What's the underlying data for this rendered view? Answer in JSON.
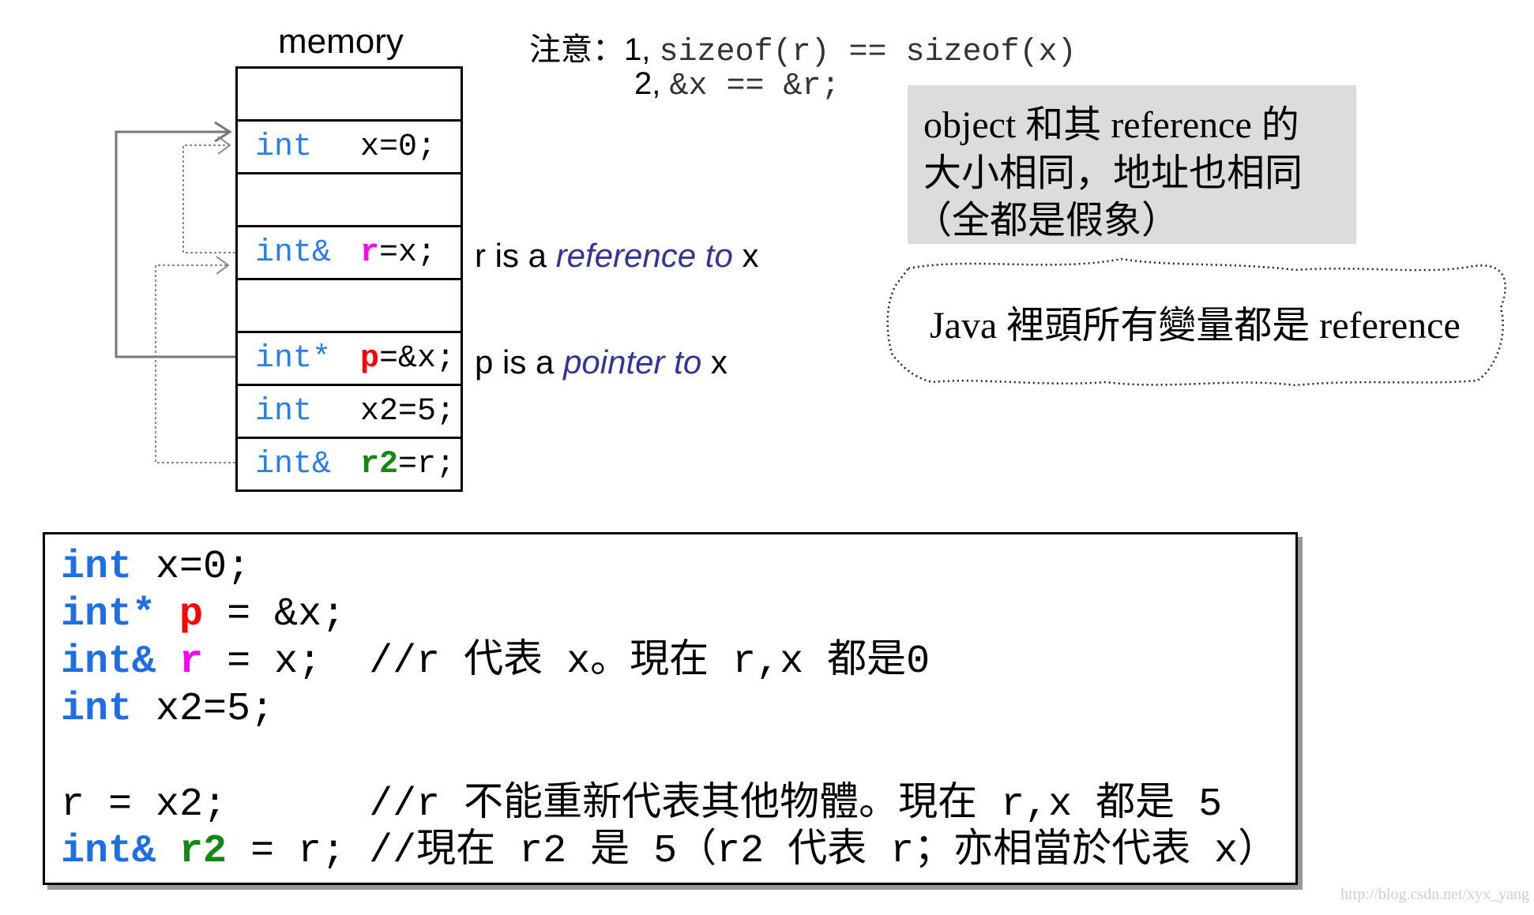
{
  "colors": {
    "type": "#2a7fe6",
    "pointer_var": "#ff0000",
    "ref_var": "#ff00ff",
    "ref2_var": "#118811",
    "gray_box": "#dcdcdc",
    "italic": "#333399"
  },
  "memory": {
    "title": "memory",
    "cells": [
      {
        "type": "",
        "value": ""
      },
      {
        "type": "int",
        "value": "x=0;"
      },
      {
        "type": "",
        "value": ""
      },
      {
        "type": "int&",
        "var": "r",
        "rest": "=x;"
      },
      {
        "type": "",
        "value": ""
      },
      {
        "type": "int*",
        "var": "p",
        "rest": "=&x;"
      },
      {
        "type": "int",
        "value": "x2=5;"
      },
      {
        "type": "int&",
        "var": "r2",
        "rest": "=r;"
      }
    ]
  },
  "notes": {
    "label": "注意：",
    "line1_num": "1,",
    "line1_code": "sizeof(r) == sizeof(x)",
    "line2_num": "2,",
    "line2_code": "&x == &r;"
  },
  "annotations": {
    "ref": {
      "pre": "r is a ",
      "em": "reference to",
      "post": " x"
    },
    "ptr": {
      "pre": "p is a ",
      "em": "pointer to",
      "post": " x"
    }
  },
  "gray_box": {
    "lines": [
      "object 和其 reference 的",
      "大小相同，地址也相同",
      "（全都是假象）"
    ]
  },
  "cloud": {
    "text": "Java 裡頭所有變量都是 reference"
  },
  "code": {
    "l1": {
      "kw": "int",
      "rest": " x=0;"
    },
    "l2": {
      "kw": "int*",
      "var": "p",
      "rest": " = &x;"
    },
    "l3": {
      "kw": "int&",
      "var": "r",
      "rest": " = x;  //r 代表 x。現在 r,x 都是0"
    },
    "l4": {
      "kw": "int",
      "rest": " x2=5;"
    },
    "l6": {
      "rest": "r = x2;      //r 不能重新代表其他物體。現在 r,x 都是 5"
    },
    "l7": {
      "kw": "int&",
      "var": "r2",
      "rest": " = r; //現在 r2 是 5（r2 代表 r；亦相當於代表 x）"
    }
  },
  "watermark": "http://blog.csdn.net/xyx_yang"
}
